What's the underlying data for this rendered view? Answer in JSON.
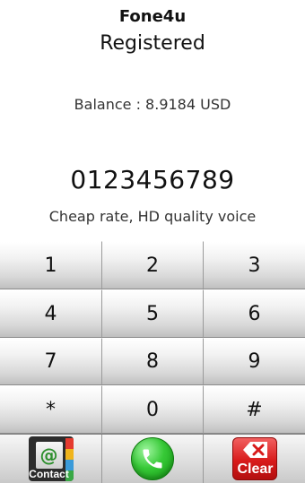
{
  "app": {
    "title": "Fone4u",
    "status": "Registered"
  },
  "balance": {
    "text": "Balance : 8.9184 USD"
  },
  "dialer": {
    "number": "0123456789",
    "tagline": "Cheap rate, HD quality voice"
  },
  "keypad": {
    "keys": [
      "1",
      "2",
      "3",
      "4",
      "5",
      "6",
      "7",
      "8",
      "9",
      "*",
      "0",
      "#"
    ]
  },
  "actions": {
    "contact_label": "Contact",
    "contact_at": "@",
    "call_icon": "phone-handset-icon",
    "clear_label": "Clear"
  },
  "colors": {
    "call_green": "#37c937",
    "clear_red": "#d81b1b"
  }
}
